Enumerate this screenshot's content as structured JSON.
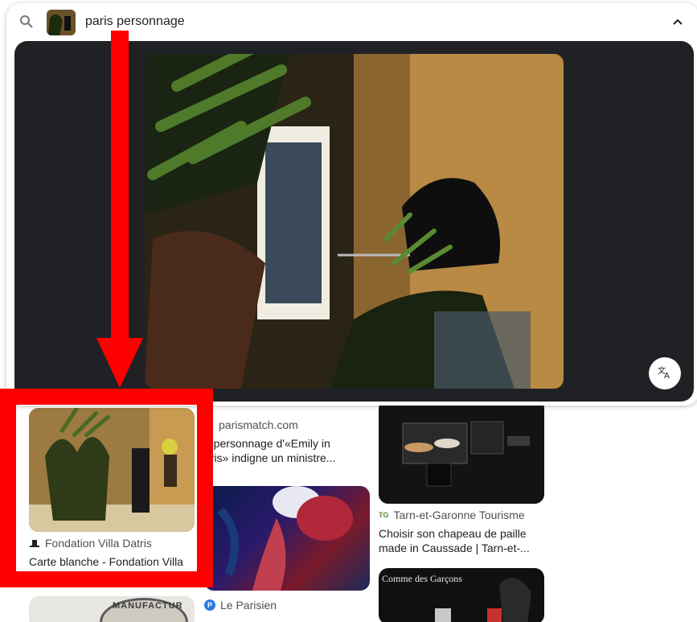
{
  "search": {
    "query": "paris personnage",
    "icons": {
      "search": "search-icon",
      "collapse": "chevron-up-icon",
      "translate": "translate-icon"
    }
  },
  "results": [
    {
      "source": "Fondation Villa Datris",
      "title": "Carte blanche - Fondation Villa"
    },
    {
      "source": "parismatch.com",
      "title_line1": "n personnage d'«Emily in",
      "title_line2": "aris» indigne un ministre..."
    },
    {
      "source": "Tarn-et-Garonne Tourisme",
      "title_line1": "Choisir son chapeau de paille",
      "title_line2": "made in Caussade | Tarn-et-..."
    },
    {
      "source": "Le Parisien"
    },
    {
      "image_text": "Comme des Garçons"
    },
    {
      "image_text": "MANUFACTUR"
    }
  ],
  "colors": {
    "annotation": "#ff0000",
    "preview_bg": "#202124"
  }
}
